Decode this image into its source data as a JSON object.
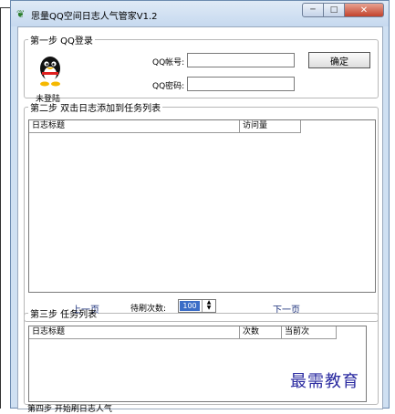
{
  "window": {
    "title": "思量QQ空间日志人气管家V1.2",
    "min_glyph": "─",
    "max_glyph": "□",
    "close_glyph": "✕"
  },
  "login": {
    "legend": "第一步 QQ登录",
    "status": "未登陆",
    "account_label": "QQ帐号:",
    "password_label": "QQ密码:",
    "account_value": "",
    "password_value": "",
    "confirm_button": "确定"
  },
  "add": {
    "legend": "第二步 双击日志添加到任务列表",
    "columns": [
      "日志标题",
      "访问量"
    ],
    "prev": "上一页",
    "next": "下一页",
    "spin_label": "待刷次数:",
    "spin_value": "100"
  },
  "tasks": {
    "legend": "第三步 任务列表",
    "columns": [
      "日志标题",
      "次数",
      "当前次"
    ]
  },
  "footer": {
    "partial_label": "第四步 开始刷日志人气",
    "watermark": "最需教育"
  }
}
